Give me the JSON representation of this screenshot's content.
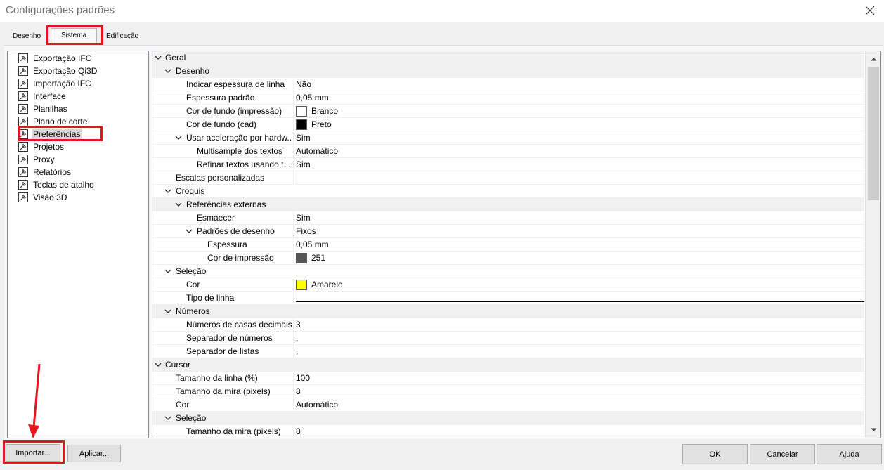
{
  "window": {
    "title": "Configurações padrões"
  },
  "tabs": [
    {
      "label": "Desenho"
    },
    {
      "label": "Sistema"
    },
    {
      "label": "Edificação"
    }
  ],
  "sidebar": {
    "items": [
      {
        "label": "Exportação IFC"
      },
      {
        "label": "Exportação Qi3D"
      },
      {
        "label": "Importação IFC"
      },
      {
        "label": "Interface"
      },
      {
        "label": "Planilhas"
      },
      {
        "label": "Plano de corte"
      },
      {
        "label": "Preferências"
      },
      {
        "label": "Projetos"
      },
      {
        "label": "Proxy"
      },
      {
        "label": "Relatórios"
      },
      {
        "label": "Teclas de atalho"
      },
      {
        "label": "Visão 3D"
      }
    ]
  },
  "grid": {
    "rows": [
      {
        "name": "Geral",
        "value": ""
      },
      {
        "name": "Desenho",
        "value": ""
      },
      {
        "name": "Indicar espessura de linha",
        "value": "Não"
      },
      {
        "name": "Espessura padrão",
        "value": "0,05 mm"
      },
      {
        "name": "Cor de fundo (impressão)",
        "value": "Branco",
        "color": "#ffffff"
      },
      {
        "name": "Cor de fundo (cad)",
        "value": "Preto",
        "color": "#000000"
      },
      {
        "name": "Usar aceleração por hardw...",
        "value": "Sim"
      },
      {
        "name": "Multisample dos textos",
        "value": "Automático"
      },
      {
        "name": "Refinar textos usando t...",
        "value": "Sim"
      },
      {
        "name": "Escalas personalizadas",
        "value": ""
      },
      {
        "name": "Croquis",
        "value": ""
      },
      {
        "name": "Referências externas",
        "value": ""
      },
      {
        "name": "Esmaecer",
        "value": "Sim"
      },
      {
        "name": "Padrões de desenho",
        "value": "Fixos"
      },
      {
        "name": "Espessura",
        "value": "0,05 mm"
      },
      {
        "name": "Cor de impressão",
        "value": "251",
        "color": "#555555"
      },
      {
        "name": "Seleção",
        "value": ""
      },
      {
        "name": "Cor",
        "value": "Amarelo",
        "color": "#ffff00"
      },
      {
        "name": "Tipo de linha",
        "value": ""
      },
      {
        "name": "Números",
        "value": ""
      },
      {
        "name": "Números de casas decimais",
        "value": "3"
      },
      {
        "name": "Separador de números",
        "value": "."
      },
      {
        "name": "Separador de listas",
        "value": ","
      },
      {
        "name": "Cursor",
        "value": ""
      },
      {
        "name": "Tamanho da linha (%)",
        "value": "100"
      },
      {
        "name": "Tamanho da mira (pixels)",
        "value": "8"
      },
      {
        "name": "Cor",
        "value": "Automático"
      },
      {
        "name": "Seleção",
        "value": ""
      },
      {
        "name": "Tamanho da mira (pixels)",
        "value": "8"
      }
    ]
  },
  "buttons": {
    "import": "Importar...",
    "apply": "Aplicar...",
    "ok": "OK",
    "cancel": "Cancelar",
    "help": "Ajuda"
  },
  "colors": {
    "highlight": "#e8141b",
    "selected_bg": "#d9d9d9"
  }
}
